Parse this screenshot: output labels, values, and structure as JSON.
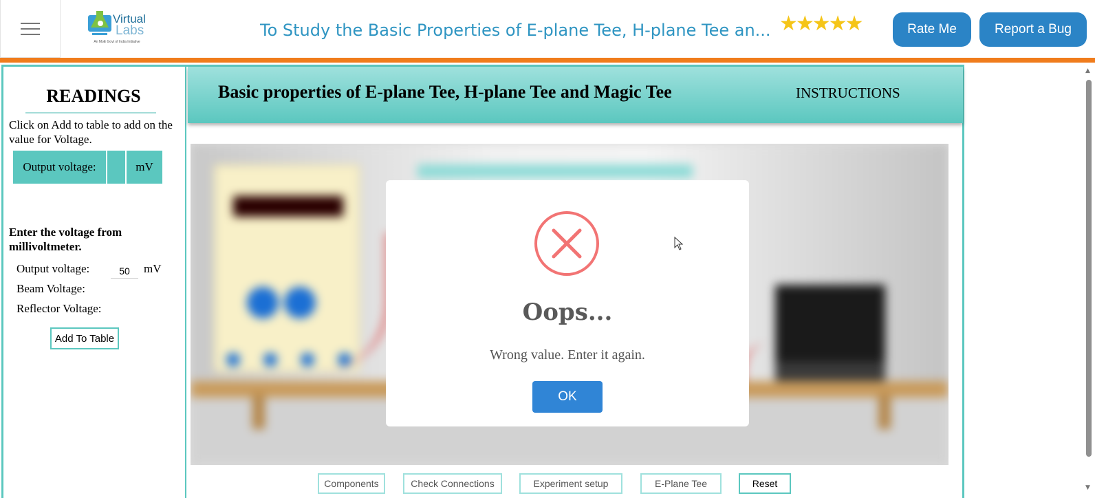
{
  "header": {
    "logo_line1": "Virtual",
    "logo_line2": "Labs",
    "logo_tagline": "An MoE Govt of India Initiative",
    "title": "To Study the Basic Properties of E-plane Tee, H-plane Tee an...",
    "rating_stars": "★★★★★",
    "rate_label": "Rate Me",
    "bug_label": "Report a Bug",
    "colors": {
      "accent": "#2b84c6",
      "orange": "#f07c1c",
      "title": "#2f95c2"
    }
  },
  "sidebar": {
    "title": "READINGS",
    "instruction": "Click on Add to table to add on the value for Voltage.",
    "table": {
      "label": "Output voltage:",
      "value": "",
      "unit": "mV"
    },
    "enter_label": "Enter the voltage from millivoltmeter.",
    "output_label": "Output voltage:",
    "output_value": "50",
    "output_unit": "mV",
    "beam_label": "Beam Voltage:",
    "reflector_label": "Reflector Voltage:",
    "add_button": "Add To Table"
  },
  "banner": {
    "title": "Basic properties of E-plane Tee, H-plane Tee and Magic Tee",
    "instructions": "INSTRUCTIONS",
    "color": "#5bc7bf"
  },
  "bottom_buttons": [
    "Components",
    "Check Connections",
    "Experiment setup",
    "E-Plane Tee",
    "Reset"
  ],
  "modal": {
    "icon": "error-x-icon",
    "title": "Oops...",
    "message": "Wrong value. Enter it again.",
    "ok_label": "OK",
    "colors": {
      "error": "#f27474",
      "ok": "#3085d6"
    }
  }
}
